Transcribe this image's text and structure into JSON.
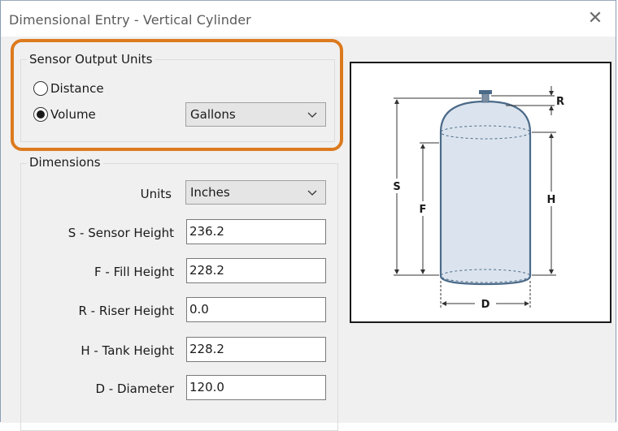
{
  "window": {
    "title": "Dimensional Entry - Vertical Cylinder",
    "close_glyph": "✕"
  },
  "sensor_output": {
    "group_label": "Sensor Output Units",
    "radio_distance": "Distance",
    "radio_volume": "Volume",
    "selected": "Volume",
    "volume_units": "Gallons"
  },
  "dimensions": {
    "group_label": "Dimensions",
    "units_label": "Units",
    "units_value": "Inches",
    "fields": [
      {
        "label": "S - Sensor Height",
        "value": "236.2"
      },
      {
        "label": "F - Fill Height",
        "value": "228.2"
      },
      {
        "label": "R - Riser Height",
        "value": "0.0"
      },
      {
        "label": "H - Tank Height",
        "value": "228.2"
      },
      {
        "label": "D - Diameter",
        "value": "120.0"
      }
    ]
  },
  "diagram": {
    "label_s": "S",
    "label_f": "F",
    "label_r": "R",
    "label_h": "H",
    "label_d": "D"
  },
  "colors": {
    "highlight": "#dc7a1e",
    "tank_fill": "#dbe4ee",
    "tank_stroke": "#4b6a88"
  }
}
